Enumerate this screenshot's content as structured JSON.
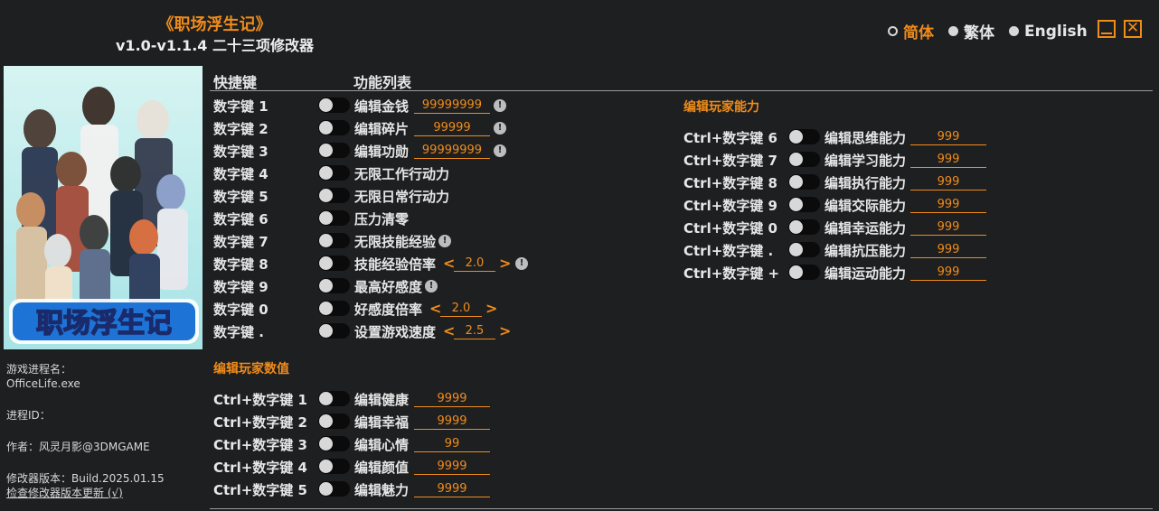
{
  "header": {
    "title": "《职场浮生记》",
    "subtitle": "v1.0-v1.1.4 二十三项修改器"
  },
  "languages": [
    {
      "label": "简体",
      "selected": true
    },
    {
      "label": "繁体",
      "selected": false
    },
    {
      "label": "English",
      "selected": false
    }
  ],
  "window_controls": {
    "minimize_icon": "minimize-icon",
    "close_icon": "close-icon",
    "close_glyph": "✕"
  },
  "cover": {
    "logo_text": "职场浮生记"
  },
  "sidebar": {
    "process_label": "游戏进程名：",
    "process_value": "OfficeLife.exe",
    "pid_label": "进程ID：",
    "author": "作者：风灵月影@3DMGAME",
    "version": "修改器版本：Build.2025.01.15",
    "update_link": "检查修改器版本更新 (√)"
  },
  "columns": {
    "hotkey": "快捷键",
    "functions": "功能列表"
  },
  "icons": {
    "info": "!",
    "left": "<",
    "right": ">"
  },
  "main_list": [
    {
      "key": "数字键 1",
      "label": "编辑金钱",
      "value": "99999999",
      "info": true
    },
    {
      "key": "数字键 2",
      "label": "编辑碎片",
      "value": "99999",
      "info": true
    },
    {
      "key": "数字键 3",
      "label": "编辑功勋",
      "value": "99999999",
      "info": true
    },
    {
      "key": "数字键 4",
      "label": "无限工作行动力"
    },
    {
      "key": "数字键 5",
      "label": "无限日常行动力"
    },
    {
      "key": "数字键 6",
      "label": "压力清零"
    },
    {
      "key": "数字键 7",
      "label": "无限技能经验",
      "info": true
    },
    {
      "key": "数字键 8",
      "label": "技能经验倍率",
      "stepper": "2.0",
      "info": true
    },
    {
      "key": "数字键 9",
      "label": "最高好感度",
      "info": true
    },
    {
      "key": "数字键 0",
      "label": "好感度倍率",
      "stepper": "2.0"
    },
    {
      "key": "数字键 .",
      "label": "设置游戏速度",
      "stepper": "2.5"
    }
  ],
  "player_values": {
    "title": "编辑玩家数值",
    "items": [
      {
        "key": "Ctrl+数字键 1",
        "label": "编辑健康",
        "value": "9999"
      },
      {
        "key": "Ctrl+数字键 2",
        "label": "编辑幸福",
        "value": "9999"
      },
      {
        "key": "Ctrl+数字键 3",
        "label": "编辑心情",
        "value": "99"
      },
      {
        "key": "Ctrl+数字键 4",
        "label": "编辑颜值",
        "value": "9999"
      },
      {
        "key": "Ctrl+数字键 5",
        "label": "编辑魅力",
        "value": "9999"
      }
    ]
  },
  "player_abilities": {
    "title": "编辑玩家能力",
    "items": [
      {
        "key": "Ctrl+数字键 6",
        "label": "编辑思维能力",
        "value": "999"
      },
      {
        "key": "Ctrl+数字键 7",
        "label": "编辑学习能力",
        "value": "999"
      },
      {
        "key": "Ctrl+数字键 8",
        "label": "编辑执行能力",
        "value": "999"
      },
      {
        "key": "Ctrl+数字键 9",
        "label": "编辑交际能力",
        "value": "999"
      },
      {
        "key": "Ctrl+数字键 0",
        "label": "编辑幸运能力",
        "value": "999"
      },
      {
        "key": "Ctrl+数字键 .",
        "label": "编辑抗压能力",
        "value": "999"
      },
      {
        "key": "Ctrl+数字键 +",
        "label": "编辑运动能力",
        "value": "999"
      }
    ]
  }
}
